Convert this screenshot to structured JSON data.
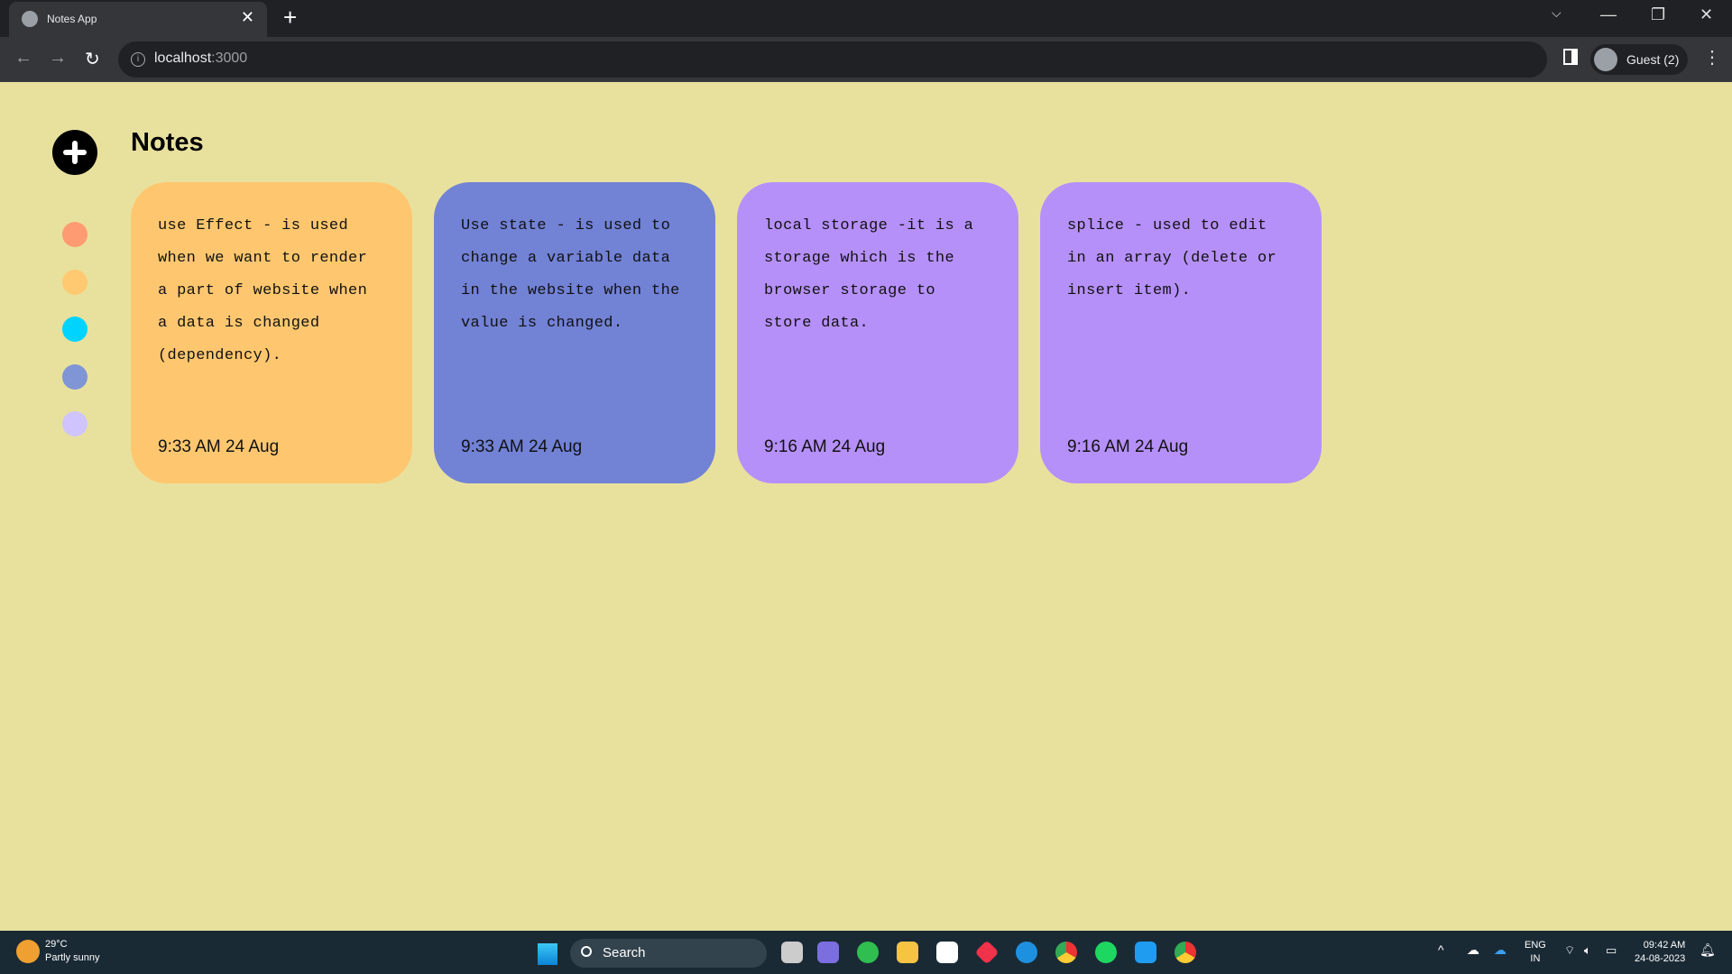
{
  "browser": {
    "tab_title": "Notes App",
    "url_host": "localhost",
    "url_port": ":3000",
    "profile": "Guest (2)"
  },
  "app": {
    "title": "Notes",
    "add_icon": "plus-circle-icon",
    "palette": [
      "#fe9b72",
      "#fec971",
      "#00d4fe",
      "#7f95d6",
      "#d0c4fe"
    ],
    "notes": [
      {
        "text": "use Effect - is used when we want to render a part of website when a data is changed (dependency).",
        "date": "9:33 AM 24 Aug",
        "color": "#fec76f"
      },
      {
        "text": "Use state - is used to change a variable data in the website when the value is changed.",
        "date": "9:33 AM 24 Aug",
        "color": "#7282d5"
      },
      {
        "text": "local storage -it is a storage which is the browser storage to store data.",
        "date": "9:16 AM 24 Aug",
        "color": "#b690f9"
      },
      {
        "text": "splice - used to edit in an array (delete or insert item).",
        "date": "9:16 AM 24 Aug",
        "color": "#b690f9"
      }
    ]
  },
  "taskbar": {
    "temp": "29°C",
    "weather": "Partly sunny",
    "search": "Search",
    "lang1": "ENG",
    "lang2": "IN",
    "time": "09:42 AM",
    "date": "24-08-2023"
  }
}
